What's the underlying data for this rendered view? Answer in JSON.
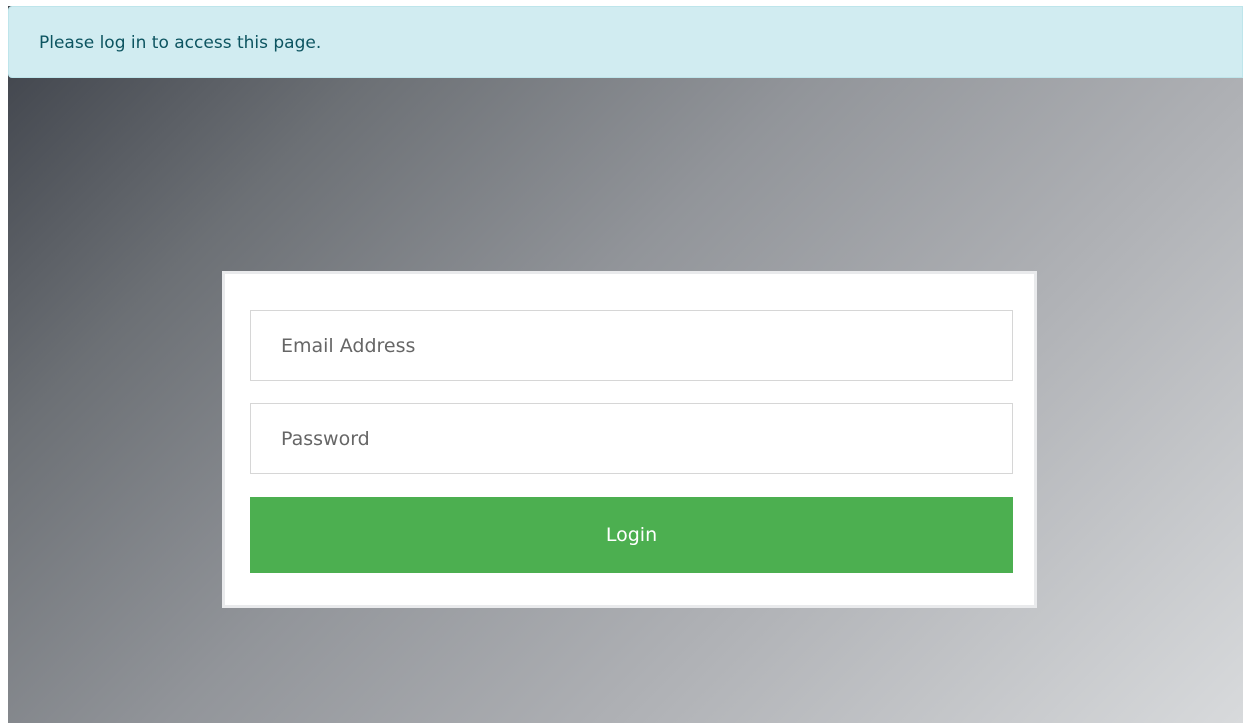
{
  "alert": {
    "message": "Please log in to access this page."
  },
  "login_form": {
    "email_placeholder": "Email Address",
    "password_placeholder": "Password",
    "submit_label": "Login"
  },
  "colors": {
    "alert_background": "#d1ecf1",
    "alert_text": "#0c5460",
    "login_button": "#4caf50"
  }
}
